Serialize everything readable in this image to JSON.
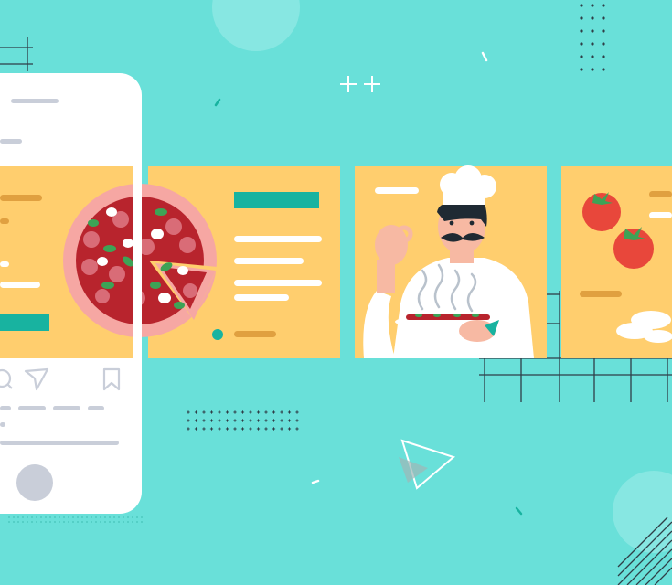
{
  "colors": {
    "background": "#69E0D9",
    "card": "#FFCE6E",
    "teal": "#18B3A0",
    "phone_body": "#FFFFFF",
    "phone_ui": "#C9CED9",
    "lines": "#2F3E47",
    "tomato": "#E8473B",
    "pizza_sauce": "#B8242D",
    "pizza_crust": "#F6A7A3",
    "pepperoni": "#D96C77",
    "basil": "#3DA356",
    "mushroom": "#FFFFFF",
    "chef_skin": "#F7B9A3",
    "chef_hair": "#1F2A33"
  },
  "illustration": {
    "phone": {
      "icons": [
        "comment-icon",
        "send-icon",
        "bookmark-icon"
      ]
    },
    "cards": [
      {
        "content": "pizza-left-half"
      },
      {
        "content": "pizza-right-half-with-text"
      },
      {
        "content": "chef-holding-pizza"
      },
      {
        "content": "tomatoes-and-mozzarella"
      }
    ]
  }
}
